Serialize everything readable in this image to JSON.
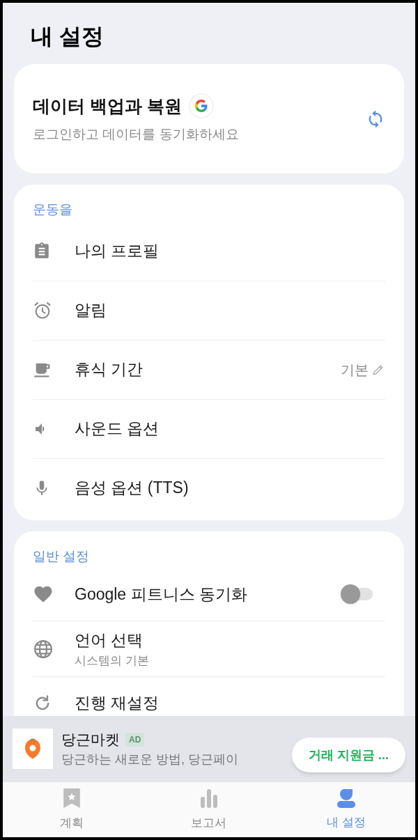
{
  "title": "내 설정",
  "backup": {
    "title": "데이터 백업과 복원",
    "subtitle": "로그인하고 데이터를 동기화하세요"
  },
  "sections": [
    {
      "label": "운동을",
      "items": [
        {
          "kind": "plain",
          "label": "나의 프로필"
        },
        {
          "kind": "plain",
          "label": "알림"
        },
        {
          "kind": "value",
          "label": "휴식 기간",
          "value": "기본"
        },
        {
          "kind": "plain",
          "label": "사운드 옵션"
        },
        {
          "kind": "plain",
          "label": "음성 옵션 (TTS)"
        }
      ]
    },
    {
      "label": "일반 설정",
      "items": [
        {
          "kind": "toggle",
          "label": "Google 피트니스 동기화",
          "on": false
        },
        {
          "kind": "subtitle",
          "label": "언어 선택",
          "subtitle": "시스템의 기본"
        },
        {
          "kind": "plain",
          "label": "진행 재설정"
        }
      ]
    }
  ],
  "ad": {
    "name": "당근마켓",
    "badge": "AD",
    "text": "당근하는 새로운 방법, 당근페이",
    "button": "거래 지원금 ..."
  },
  "tabs": [
    {
      "label": "계획",
      "selected": false
    },
    {
      "label": "보고서",
      "selected": false
    },
    {
      "label": "내 설정",
      "selected": true
    }
  ]
}
